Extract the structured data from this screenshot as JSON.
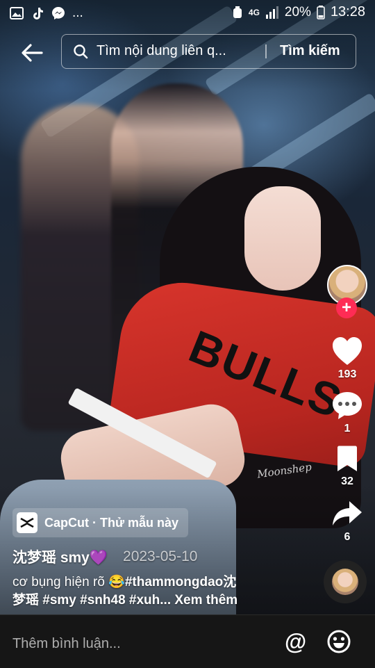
{
  "status_bar": {
    "network": "4G",
    "battery": "20%",
    "time": "13:28",
    "left_icons": [
      "gallery-icon",
      "tiktok-icon",
      "messenger-icon"
    ],
    "more": "..."
  },
  "header": {
    "search_text": "Tìm nội dung liên q...",
    "search_button": "Tìm kiếm"
  },
  "video": {
    "watermark": "Moonshep"
  },
  "actions": {
    "likes": "193",
    "comments": "1",
    "saves": "32",
    "shares": "6",
    "follow": "+"
  },
  "capcut": {
    "label": "CapCut · Thử mẫu này"
  },
  "author": {
    "name": "沈梦瑶 smy💜",
    "date": "2023-05-10"
  },
  "caption": {
    "text_line1": "cơ bụng hiện rõ 😂",
    "hashtag1": "#thammongdao沈",
    "text_line2": "梦瑶 #smy #snh48 #xuh...",
    "more": "Xem thêm"
  },
  "comment_bar": {
    "placeholder": "Thêm bình luận...",
    "at": "@"
  },
  "colors": {
    "follow": "#fe2c55",
    "jersey": "#c92b23",
    "comment_bar_bg": "#161616"
  }
}
